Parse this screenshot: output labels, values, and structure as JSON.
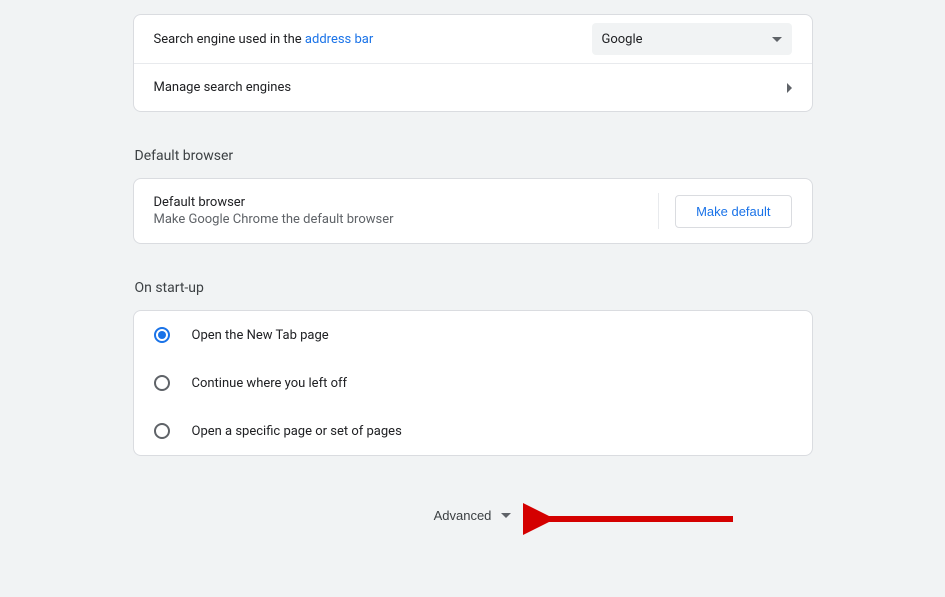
{
  "search_engine_section": {
    "label_prefix": "Search engine used in the ",
    "label_link": "address bar",
    "selected_engine": "Google",
    "manage_label": "Manage search engines"
  },
  "default_browser_section": {
    "heading": "Default browser",
    "title": "Default browser",
    "subtitle": "Make Google Chrome the default browser",
    "button_label": "Make default"
  },
  "startup_section": {
    "heading": "On start-up",
    "options": [
      {
        "label": "Open the New Tab page",
        "checked": true
      },
      {
        "label": "Continue where you left off",
        "checked": false
      },
      {
        "label": "Open a specific page or set of pages",
        "checked": false
      }
    ]
  },
  "advanced_label": "Advanced"
}
